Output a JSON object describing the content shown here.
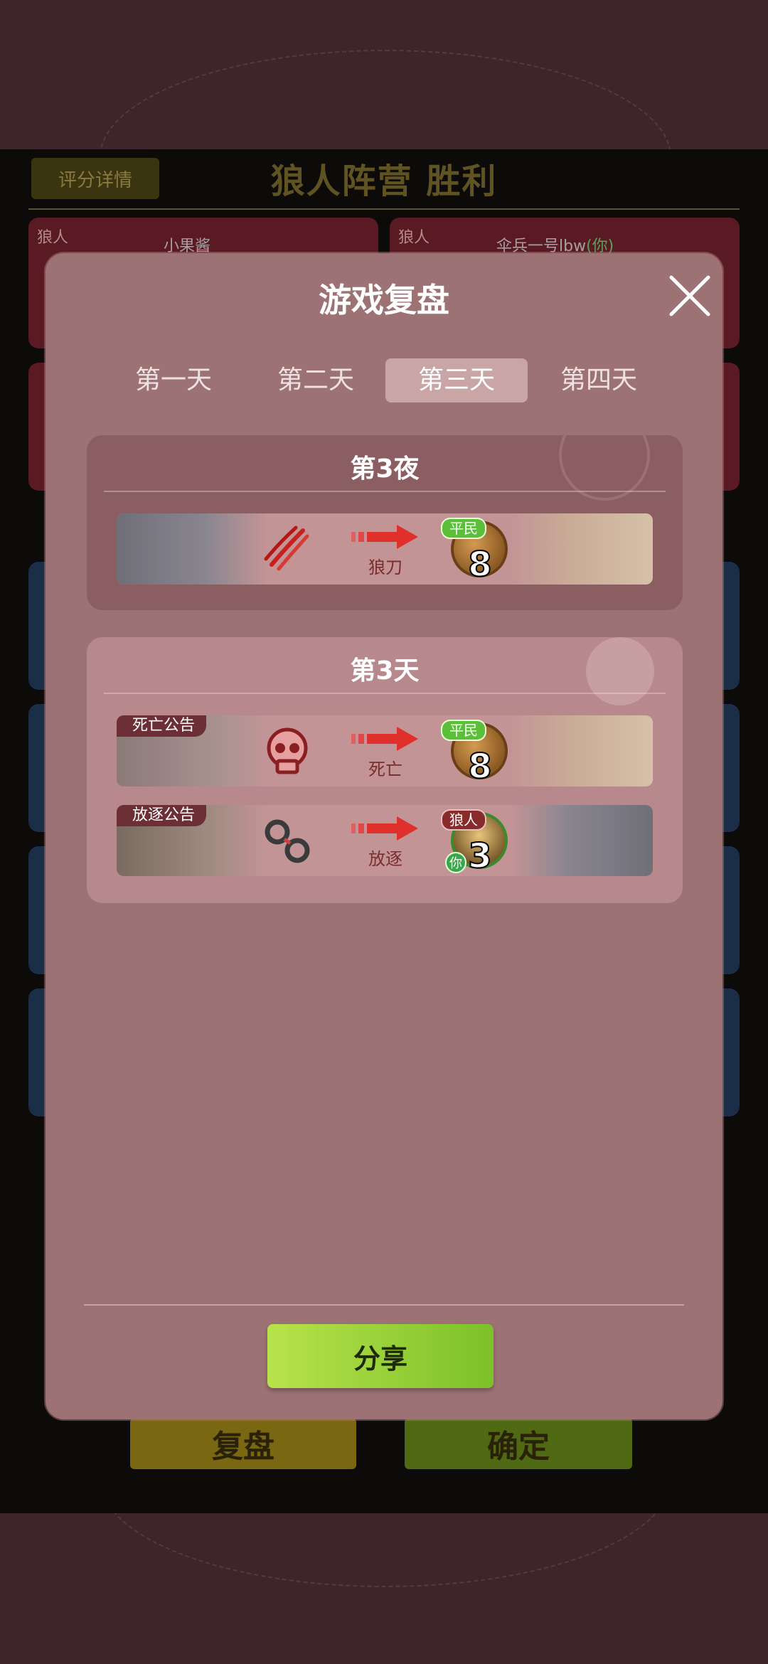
{
  "background": {
    "score_button": "评分详情",
    "result_title": "狼人阵营  胜利",
    "players": [
      {
        "role": "狼人",
        "name": "小果酱",
        "you": ""
      },
      {
        "role": "狼人",
        "name": "伞兵一号lbw",
        "you": "(你)"
      }
    ],
    "replay_button": "复盘",
    "confirm_button": "确定"
  },
  "modal": {
    "title": "游戏复盘",
    "tabs": [
      "第一天",
      "第二天",
      "第三天",
      "第四天"
    ],
    "active_tab": 2,
    "night": {
      "title": "第3夜",
      "events": [
        {
          "action": "狼刀",
          "role": "平民",
          "seat": "8"
        }
      ]
    },
    "day": {
      "title": "第3天",
      "events": [
        {
          "tag": "死亡公告",
          "action": "死亡",
          "role": "平民",
          "seat": "8"
        },
        {
          "tag": "放逐公告",
          "action": "放逐",
          "role": "狼人",
          "seat": "3",
          "you": "你"
        }
      ]
    },
    "share_button": "分享"
  },
  "colors": {
    "modal_bg": "#9d7274",
    "active_tab": "#c9a5a6",
    "share_green": "#8fcd36",
    "villager_badge": "#5bbf3a",
    "wolf_badge": "#8a2b2b",
    "arrow_red": "#e0302c"
  },
  "icons": [
    "close-icon",
    "claw-icon",
    "skull-icon",
    "handcuffs-icon",
    "red-arrow-icon"
  ]
}
